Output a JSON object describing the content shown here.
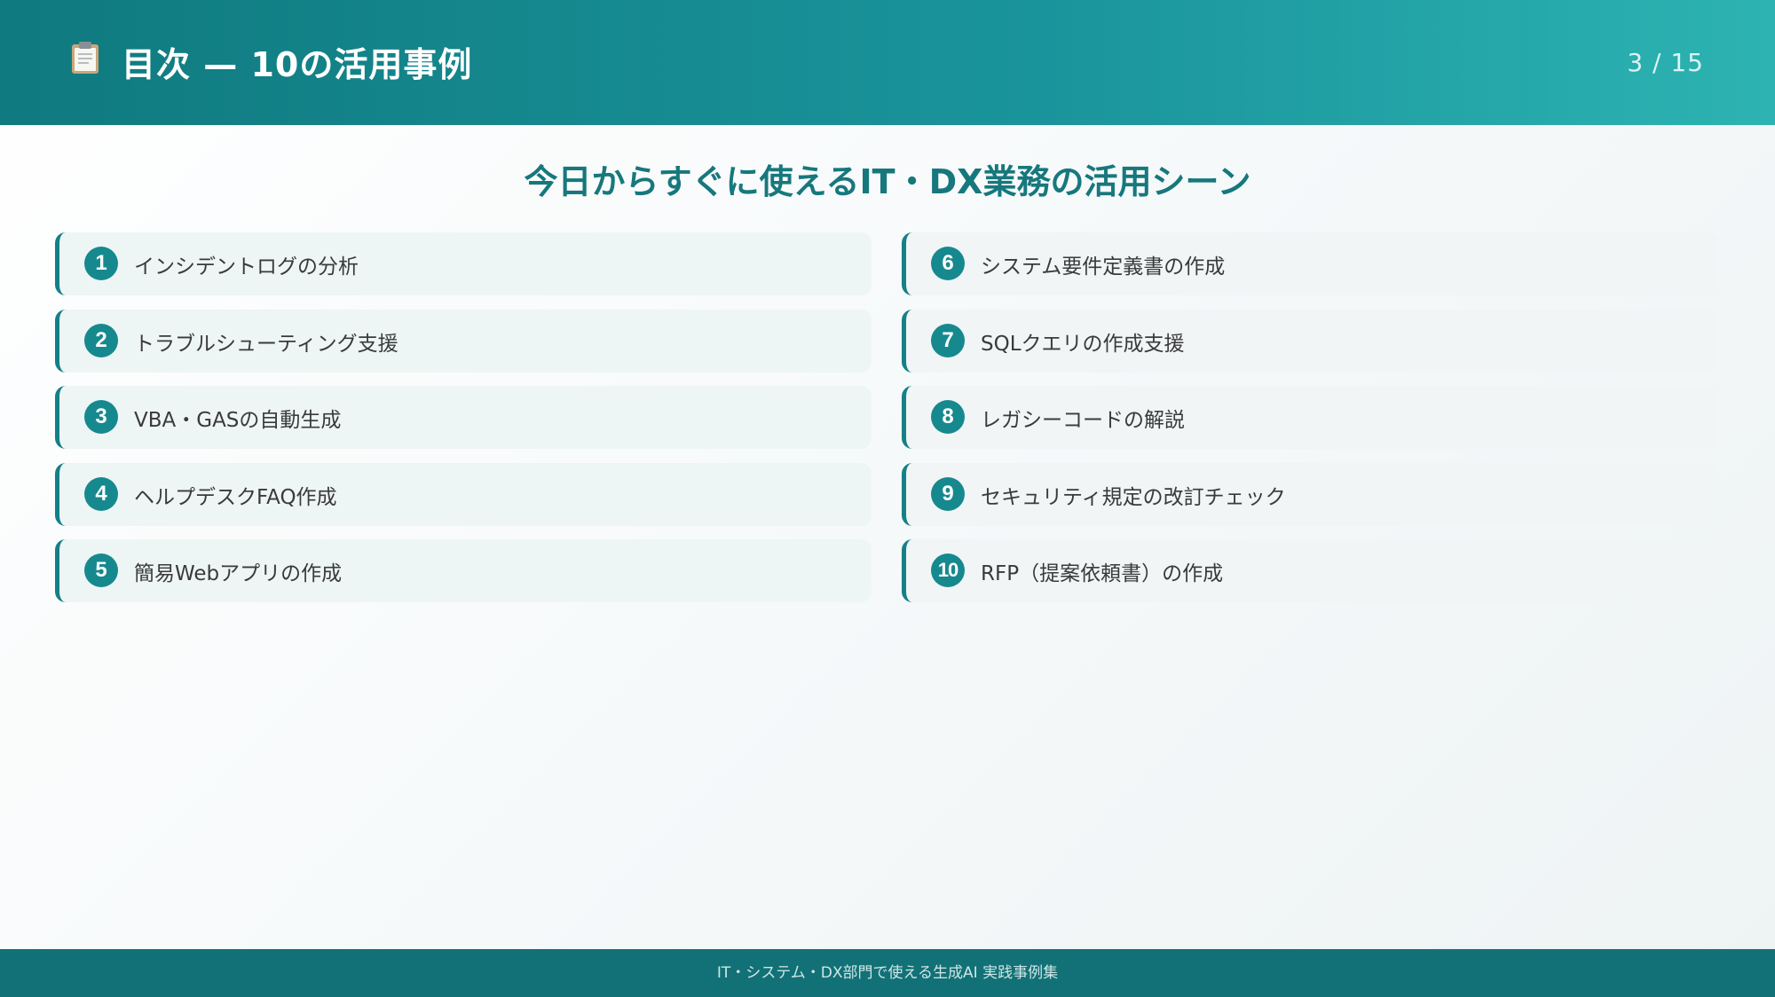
{
  "header": {
    "icon": "clipboard-icon",
    "title": "目次 — 10の活用事例",
    "page_counter": "3 / 15"
  },
  "subtitle": "今日からすぐに使えるIT・DX業務の活用シーン",
  "items": [
    {
      "number": "1",
      "label": "インシデントログの分析"
    },
    {
      "number": "2",
      "label": "トラブルシューティング支援"
    },
    {
      "number": "3",
      "label": "VBA・GASの自動生成"
    },
    {
      "number": "4",
      "label": "ヘルプデスクFAQ作成"
    },
    {
      "number": "5",
      "label": "簡易Webアプリの作成"
    },
    {
      "number": "6",
      "label": "システム要件定義書の作成"
    },
    {
      "number": "7",
      "label": "SQLクエリの作成支援"
    },
    {
      "number": "8",
      "label": "レガシーコードの解説"
    },
    {
      "number": "9",
      "label": "セキュリティ規定の改訂チェック"
    },
    {
      "number": "10",
      "label": "RFP（提案依頼書）の作成"
    }
  ],
  "footer": "IT・システム・DX部門で使える生成AI 実践事例集",
  "colors": {
    "accent": "#148088",
    "header_start": "#0f7a7f",
    "header_end": "#2db3b2",
    "footer": "#127176"
  }
}
